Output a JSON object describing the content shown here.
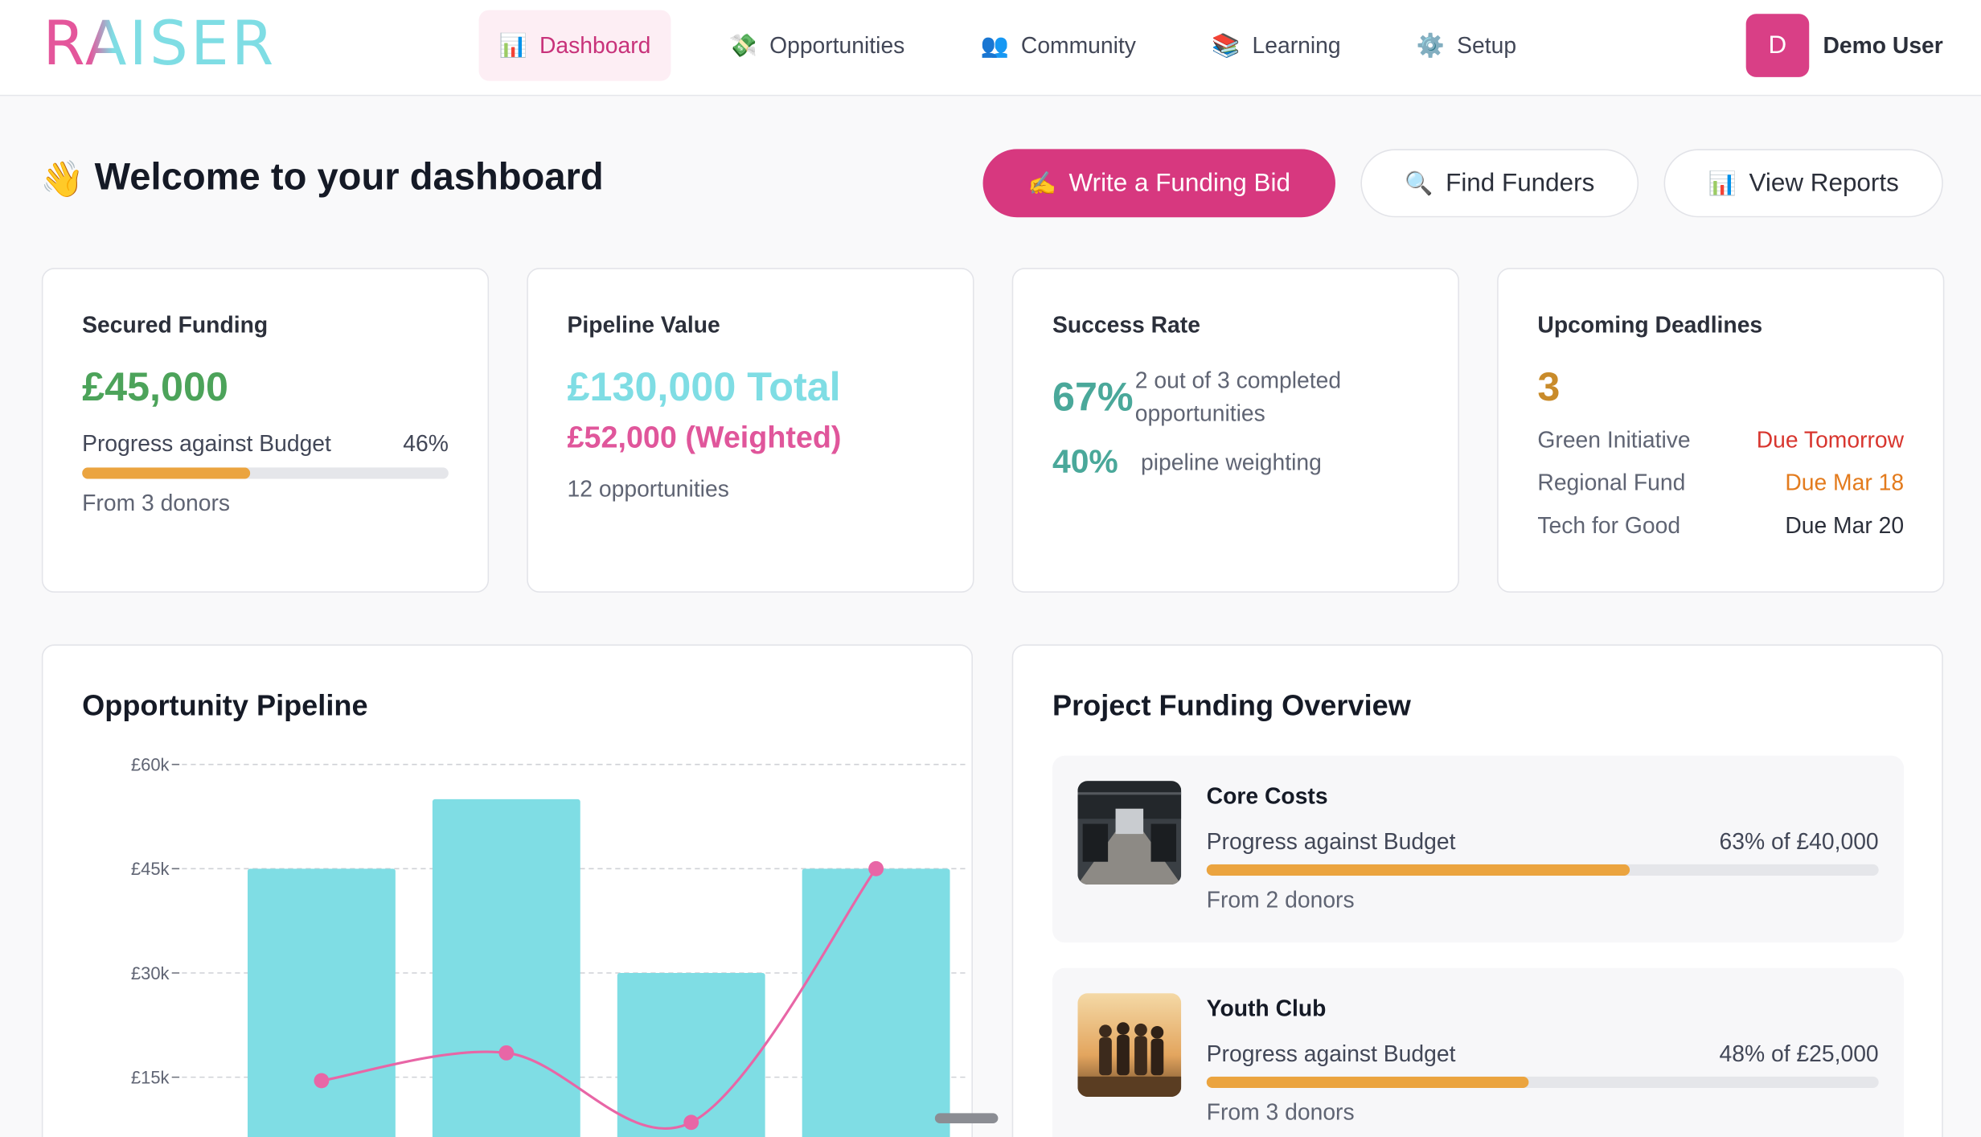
{
  "app": {
    "logo": "RAISER"
  },
  "nav": {
    "items": [
      {
        "label": "Dashboard",
        "icon": "bar-chart-icon"
      },
      {
        "label": "Opportunities",
        "icon": "money-icon"
      },
      {
        "label": "Community",
        "icon": "people-icon"
      },
      {
        "label": "Learning",
        "icon": "books-icon"
      },
      {
        "label": "Setup",
        "icon": "gear-icon"
      }
    ],
    "active": "Dashboard"
  },
  "user": {
    "initial": "D",
    "name": "Demo User"
  },
  "welcome": {
    "title": "Welcome to your dashboard",
    "icon": "waving-hand-icon"
  },
  "actions": {
    "write_bid": "Write a Funding Bid",
    "find_funders": "Find Funders",
    "view_reports": "View Reports"
  },
  "stats": {
    "secured": {
      "title": "Secured Funding",
      "amount": "£45,000",
      "progress_label": "Progress against Budget",
      "progress_pct_text": "46%",
      "progress": 0.46,
      "donors": "From 3 donors"
    },
    "pipeline": {
      "title": "Pipeline Value",
      "total": "£130,000 Total",
      "weighted": "£52,000 (Weighted)",
      "count": "12 opportunities"
    },
    "success": {
      "title": "Success Rate",
      "rate": "67%",
      "rate_desc": "2 out of 3 completed opportunities",
      "weighting": "40%",
      "weighting_desc": "pipeline weighting"
    },
    "deadlines": {
      "title": "Upcoming Deadlines",
      "count": "3",
      "items": [
        {
          "name": "Green Initiative",
          "due": "Due Tomorrow"
        },
        {
          "name": "Regional Fund",
          "due": "Due Mar 18"
        },
        {
          "name": "Tech for Good",
          "due": "Due Mar 20"
        }
      ]
    }
  },
  "pipeline_chart": {
    "title": "Opportunity Pipeline"
  },
  "chart_data": {
    "type": "bar",
    "title": "Opportunity Pipeline",
    "y_tick_labels": [
      "£60k",
      "£45k",
      "£30k",
      "£15k"
    ],
    "y_ticks": [
      60000,
      45000,
      30000,
      15000
    ],
    "ylim": [
      0,
      60000
    ],
    "grid": true,
    "series": [
      {
        "type": "bar",
        "color": "#7fdde4",
        "values": [
          45000,
          55000,
          30000,
          45000
        ]
      },
      {
        "type": "line",
        "color": "#e866a6",
        "values": [
          14500,
          18500,
          8500,
          45000
        ]
      }
    ]
  },
  "project_overview": {
    "title": "Project Funding Overview",
    "projects": [
      {
        "name": "Core Costs",
        "progress_label": "Progress against Budget",
        "progress_text": "63% of £40,000",
        "progress": 0.63,
        "donors": "From 2 donors"
      },
      {
        "name": "Youth Club",
        "progress_label": "Progress against Budget",
        "progress_text": "48% of £25,000",
        "progress": 0.48,
        "donors": "From 3 donors"
      }
    ]
  }
}
